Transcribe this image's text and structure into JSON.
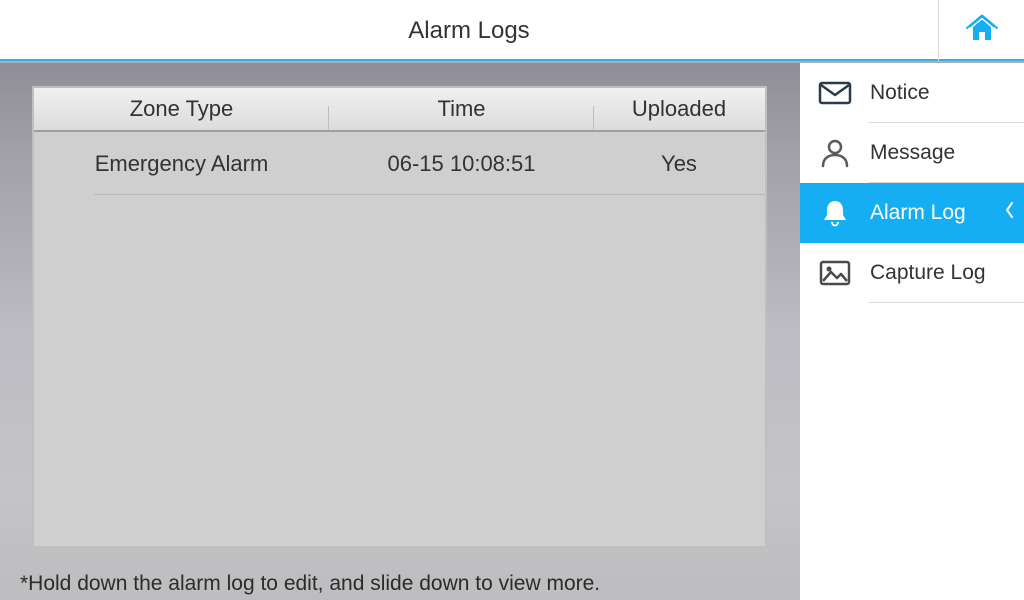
{
  "header": {
    "title": "Alarm Logs"
  },
  "table": {
    "headers": {
      "zone": "Zone Type",
      "time": "Time",
      "uploaded": "Uploaded"
    },
    "rows": [
      {
        "zone": "Emergency Alarm",
        "time": "06-15 10:08:51",
        "uploaded": "Yes"
      }
    ]
  },
  "hint": "*Hold down the alarm log to edit, and slide down to view more.",
  "sidebar": {
    "items": [
      {
        "label": "Notice"
      },
      {
        "label": "Message"
      },
      {
        "label": "Alarm Log",
        "active": true
      },
      {
        "label": "Capture Log"
      }
    ]
  }
}
